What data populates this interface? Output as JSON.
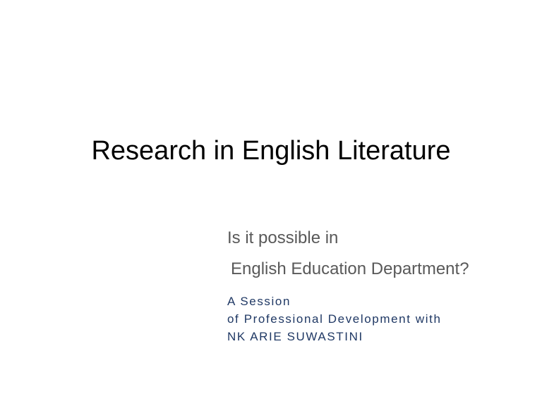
{
  "slide": {
    "title": "Research in English Literature",
    "subtitle": {
      "line1": "Is it possible in",
      "line2": "English Education Department?"
    },
    "session": {
      "line1": "A Session",
      "line2": "of Professional Development with",
      "line3": "NK ARIE SUWASTINI"
    }
  },
  "colors": {
    "title": "#000000",
    "subtitle": "#595959",
    "session": "#1f3864",
    "background": "#ffffff"
  }
}
